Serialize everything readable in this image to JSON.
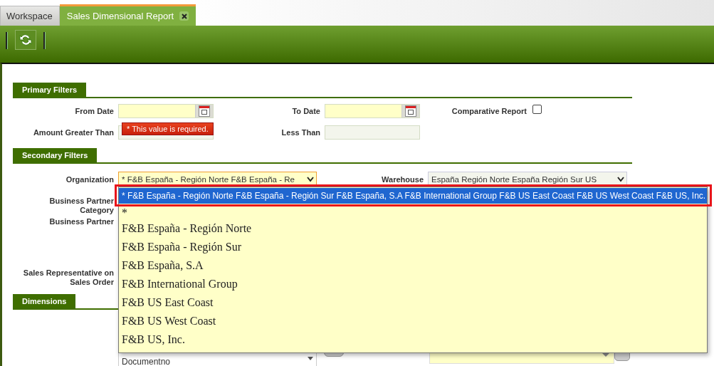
{
  "tabs": [
    {
      "label": "Workspace",
      "selected": false,
      "closable": false
    },
    {
      "label": "Sales Dimensional Report",
      "selected": true,
      "closable": true
    }
  ],
  "toolbar": {
    "buttons": [
      {
        "kind": "refresh"
      }
    ]
  },
  "primary_filters": {
    "title": "Primary Filters",
    "fields": [
      {
        "label": "From Date",
        "kind": "date",
        "required": true
      },
      {
        "label": "To Date",
        "kind": "date",
        "required": true
      },
      {
        "label": "Amount Greater Than",
        "kind": "text",
        "required": false
      },
      {
        "label": "Less Than",
        "kind": "text",
        "required": false
      }
    ],
    "comparative_report": {
      "label": "Comparative Report",
      "checked": false
    },
    "error_tooltip": "* This value is required."
  },
  "secondary_filters": {
    "title": "Secondary Filters",
    "organization": {
      "label": "Organization",
      "value": "* F&B España - Región Norte F&B España - Re"
    },
    "warehouse": {
      "label": "Warehouse",
      "value": "España Región Norte España Región Sur US"
    },
    "business_partner_category": "Business Partner Category",
    "business_partner": "Business Partner",
    "sales_representative": "Sales Representative on Sales Order"
  },
  "organization_dropdown": {
    "options": [
      {
        "label": "* F&B España - Región Norte F&B España - Región Sur F&B España, S.A F&B International Group F&B US East Coast F&B US West Coast F&B US, Inc.",
        "selected": true
      },
      {
        "label": "*",
        "selected": false
      },
      {
        "label": "F&B España - Región Norte",
        "selected": false
      },
      {
        "label": "F&B España - Región Sur",
        "selected": false
      },
      {
        "label": "F&B España, S.A",
        "selected": false
      },
      {
        "label": "F&B International Group",
        "selected": false
      },
      {
        "label": "F&B US East Coast",
        "selected": false
      },
      {
        "label": "F&B US West Coast",
        "selected": false
      },
      {
        "label": "F&B US, Inc.",
        "selected": false
      }
    ]
  },
  "dimensions": {
    "title": "Dimensions",
    "list_items": [
      "Documentno"
    ]
  }
}
